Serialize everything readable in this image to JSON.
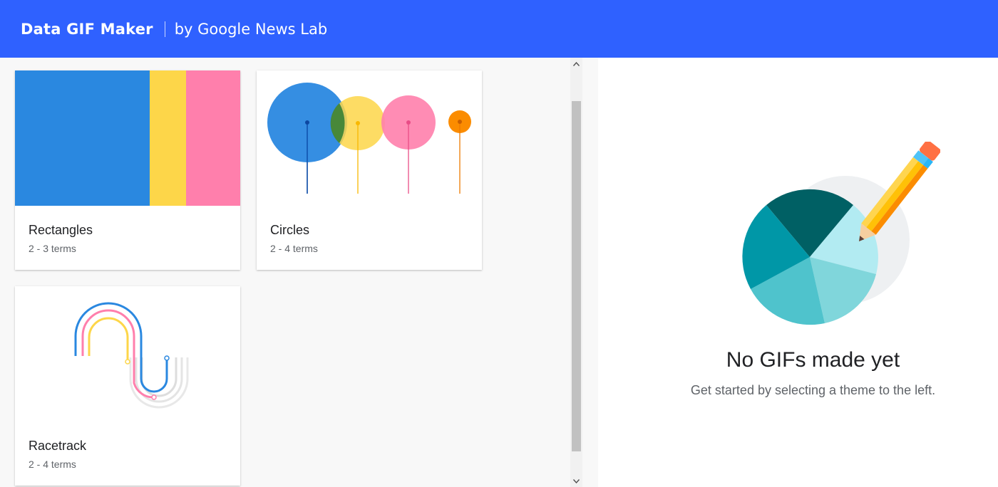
{
  "header": {
    "title": "Data GIF Maker",
    "byline": "by Google News Lab"
  },
  "themes": [
    {
      "title": "Rectangles",
      "terms": "2 - 3 terms"
    },
    {
      "title": "Circles",
      "terms": "2 - 4 terms"
    },
    {
      "title": "Racetrack",
      "terms": "2 - 4 terms"
    }
  ],
  "empty_state": {
    "title": "No GIFs made yet",
    "subtitle": "Get started by selecting a theme to the left."
  },
  "colors": {
    "header_bg": "#2f61ff",
    "blue": "#2a88e0",
    "yellow": "#fdd649",
    "pink": "#ff7fac",
    "orange": "#fb8c00",
    "teal_dark": "#006064",
    "teal": "#0097a7",
    "teal_light": "#4fc3cc"
  }
}
